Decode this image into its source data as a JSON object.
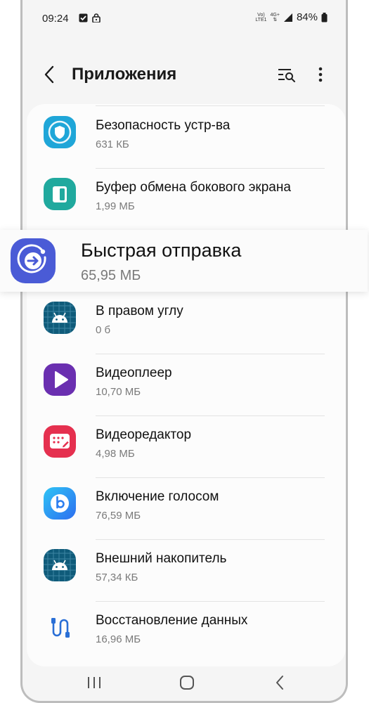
{
  "status": {
    "time": "09:24",
    "battery": "84%",
    "signal_top": "Vo)",
    "signal_bottom": "LTE1",
    "network": "4G+"
  },
  "header": {
    "title": "Приложения"
  },
  "apps": [
    {
      "name": "Безопасность устр-ва",
      "size": "631 КБ",
      "icon": "device-security-icon"
    },
    {
      "name": "Буфер обмена бокового экрана",
      "size": "1,99 МБ",
      "icon": "edge-clipboard-icon"
    },
    {
      "name": "Быстрая отправка",
      "size": "65,95 МБ",
      "icon": "quick-share-icon"
    },
    {
      "name": "В правом углу",
      "size": "0 б",
      "icon": "android-icon"
    },
    {
      "name": "Видеоплеер",
      "size": "10,70 МБ",
      "icon": "video-player-icon"
    },
    {
      "name": "Видеоредактор",
      "size": "4,98 МБ",
      "icon": "video-editor-icon"
    },
    {
      "name": "Включение голосом",
      "size": "76,59 МБ",
      "icon": "bixby-icon"
    },
    {
      "name": "Внешний накопитель",
      "size": "57,34 КБ",
      "icon": "android-icon"
    },
    {
      "name": "Восстановление данных",
      "size": "16,96 МБ",
      "icon": "data-restore-icon"
    }
  ],
  "colors": {
    "security": "#1fa6d8",
    "clipboard": "#20a99e",
    "quick_share": "#4a5bd6",
    "android_bg": "#0f5b7a",
    "video_player": "#6a2fb0",
    "video_editor": "#e5304f",
    "bixby": "#2d7ff0"
  }
}
